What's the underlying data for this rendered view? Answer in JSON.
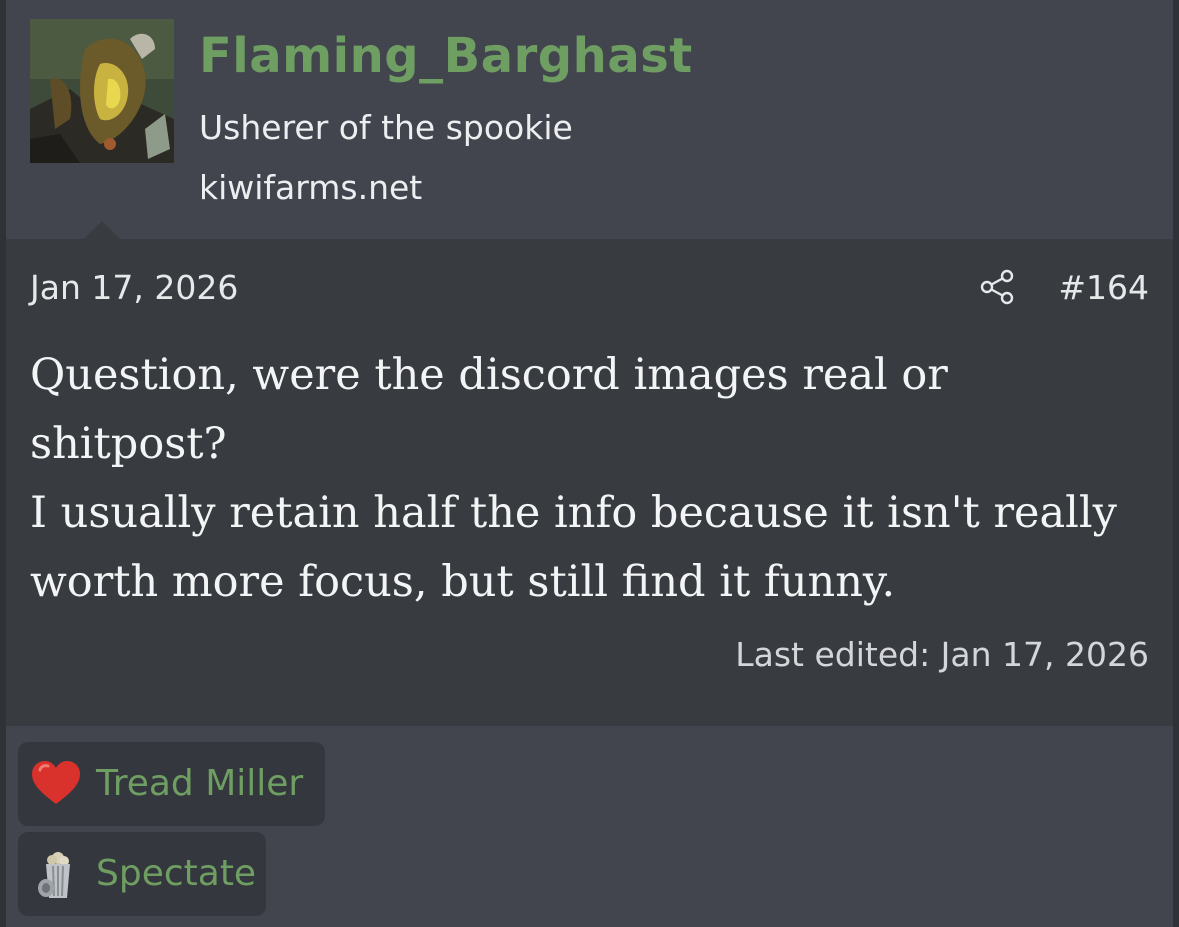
{
  "user": {
    "name": "Flaming_Barghast",
    "title": "Usherer of the spookie",
    "site": "kiwifarms.net",
    "avatar_icon": "avatar-image"
  },
  "post": {
    "date": "Jan 17, 2026",
    "number": "#164",
    "share_icon": "share-icon",
    "lines": [
      "Question, were the discord images real or shitpost?",
      "I usually retain half the info because it isn't really worth more focus, but still find it funny."
    ],
    "last_edited": "Last edited: Jan 17, 2026"
  },
  "reactions": [
    {
      "icon": "heart-icon",
      "label": "Tread Miller"
    },
    {
      "icon": "popcorn-icon",
      "label": "Spectate"
    }
  ],
  "colors": {
    "background": "#42454e",
    "post_body": "#383b40",
    "username": "#6f9e62",
    "reaction_label": "#6f9e62",
    "heart": "#d9312b"
  }
}
